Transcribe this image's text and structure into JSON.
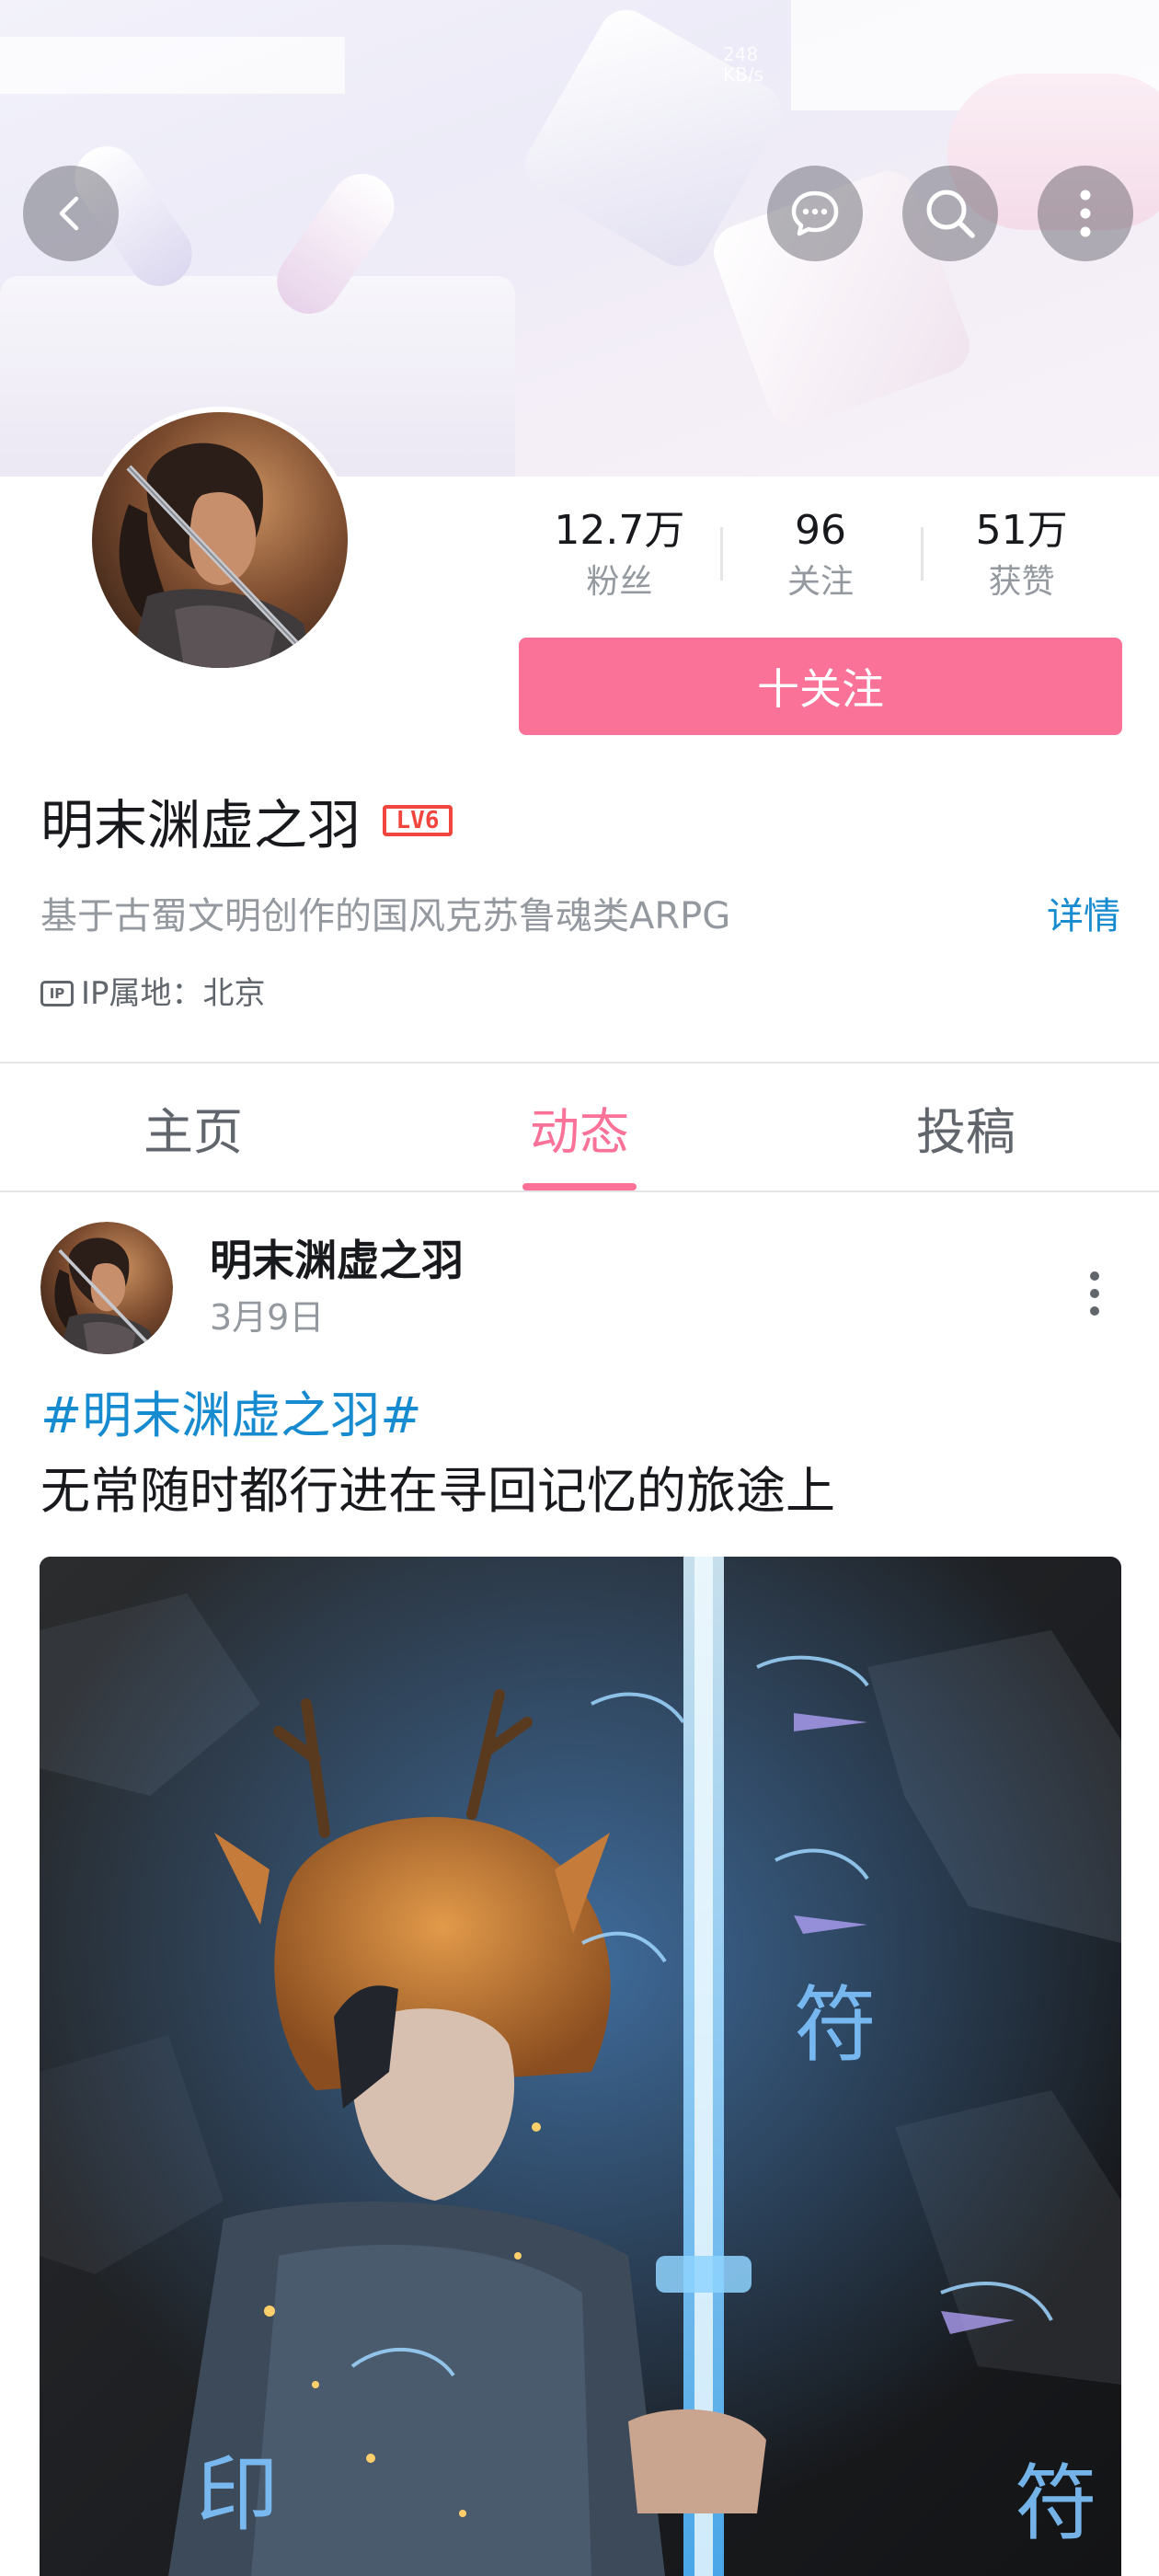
{
  "status": {
    "speed_value": "248",
    "speed_unit": "KB/s"
  },
  "header": {
    "back_icon": "chevron-left-icon",
    "message_icon": "chat-bubble-icon",
    "search_icon": "search-icon",
    "more_icon": "more-vertical-icon"
  },
  "profile": {
    "stats": [
      {
        "value": "12.7万",
        "label": "粉丝"
      },
      {
        "value": "96",
        "label": "关注"
      },
      {
        "value": "51万",
        "label": "获赞"
      }
    ],
    "follow_label": "十关注",
    "name": "明末渊虚之羽",
    "level": "LV6",
    "bio": "基于古蜀文明创作的国风克苏鲁魂类ARPG",
    "detail_label": "详情",
    "ip_icon_text": "IP",
    "ip_location": "IP属地：北京"
  },
  "tabs": [
    {
      "label": "主页",
      "active": false
    },
    {
      "label": "动态",
      "active": true
    },
    {
      "label": "投稿",
      "active": false
    }
  ],
  "post": {
    "author": "明末渊虚之羽",
    "date": "3月9日",
    "hashtag": "#明末渊虚之羽#",
    "text": "无常随时都行进在寻回记忆的旅途上"
  },
  "colors": {
    "accent_pink": "#fb7299",
    "link_blue": "#178bcf",
    "level_red": "#f2453d",
    "muted_text": "#9499a0"
  }
}
